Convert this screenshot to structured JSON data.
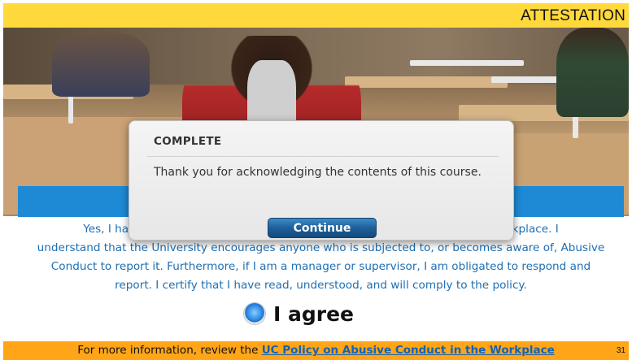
{
  "header": {
    "title": "ATTESTATION"
  },
  "attestation": {
    "line1": "Yes, I have read and understand the UC Policy on Abusive Conduct in the Workplace. I",
    "line2": "understand that the University encourages anyone who is subjected to, or becomes aware of, Abusive",
    "line3": "Conduct to report it. Furthermore,  if I am a manager or supervisor, I am obligated to respond and",
    "line4": "report. I certify that I have read, understood, and will comply to the policy."
  },
  "agree": {
    "label": "I agree",
    "selected": true
  },
  "footer": {
    "prefix": "For more information, review the ",
    "link": "UC Policy on Abusive Conduct in the Workplace",
    "page_number": "31"
  },
  "modal": {
    "title": "COMPLETE",
    "message": "Thank you for acknowledging the contents of this course.",
    "button_label": "Continue"
  },
  "colors": {
    "header_bar": "#ffd93b",
    "accent_blue": "#1e8ad6",
    "footer_bar": "#ffa517",
    "button": "#1e5f99"
  }
}
